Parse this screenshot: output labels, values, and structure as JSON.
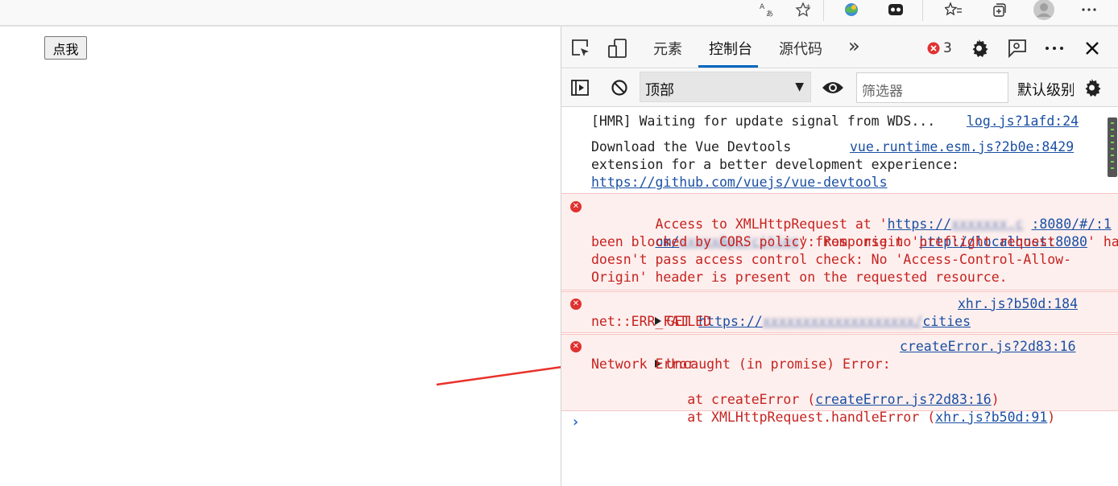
{
  "page": {
    "button_label": "点我"
  },
  "devtools": {
    "tabs": [
      {
        "label": "元素"
      },
      {
        "label": "控制台"
      },
      {
        "label": "源代码"
      }
    ],
    "more_tabs": "»",
    "error_count": "3",
    "context": "顶部",
    "filter_placeholder": "筛选器",
    "levels_label": "默认级别"
  },
  "console": {
    "messages": [
      {
        "text": "[HMR] Waiting for update signal from WDS...",
        "source": "log.js?1afd:24"
      },
      {
        "line1": "Download the Vue Devtools",
        "line2": "extension for a better development experience:",
        "link": "https://github.com/vuejs/vue-devtools",
        "source": "vue.runtime.esm.js?2b0e:8429"
      },
      {
        "pre": "Access to XMLHttpRequest at '",
        "url1a": "https://",
        "url1b": "xxxxxxx.c",
        "url1c": ":8080/#/:1",
        "url1d": "om/",
        "url1e": "xxxxxApi/cities",
        "mid": "' from origin '",
        "origin": "http://localhost:8080",
        "line3": "' has",
        "line4": "been blocked by CORS policy: Response to preflight request",
        "line5": "doesn't pass access control check: No 'Access-Control-Allow-",
        "line6": "Origin' header is present on the requested resource."
      },
      {
        "method": "GET",
        "url_a": "https://",
        "url_b": "xxxxxxxxxxxxxxxxxxx/",
        "url_c": "cities",
        "source": "xhr.js?b50d:184",
        "line2": "net::ERR_FAILED"
      },
      {
        "line1": "Uncaught (in promise) Error:",
        "source": "createError.js?2d83:16",
        "line2": "Network Error",
        "stack1_pre": "    at createError (",
        "stack1_link": "createError.js?2d83:16",
        "stack1_post": ")",
        "stack2_pre": "    at XMLHttpRequest.handleError (",
        "stack2_link": "xhr.js?b50d:91",
        "stack2_post": ")"
      }
    ],
    "prompt": "›"
  },
  "colors": {
    "error_text": "#c5231f",
    "error_bg": "#fdefee",
    "link": "#1a4fa3",
    "arrow": "#e8312a",
    "tab_underline": "#0067c0"
  },
  "icons": {
    "browser_toolbar": [
      "translate-icon",
      "favorite-star-icon",
      "extension-globe-icon",
      "extension-mask-icon",
      "favorites-list-icon",
      "collections-icon",
      "profile-avatar-icon",
      "menu-dots-icon"
    ],
    "devtools_toolbar": [
      "inspect-element-icon",
      "device-emulation-icon",
      "error-circle-icon",
      "settings-gear-icon",
      "feedback-icon",
      "more-dots-icon",
      "close-icon"
    ],
    "filter_bar": [
      "sidebar-toggle-icon",
      "clear-console-icon",
      "eye-icon",
      "settings-gear-icon"
    ]
  }
}
